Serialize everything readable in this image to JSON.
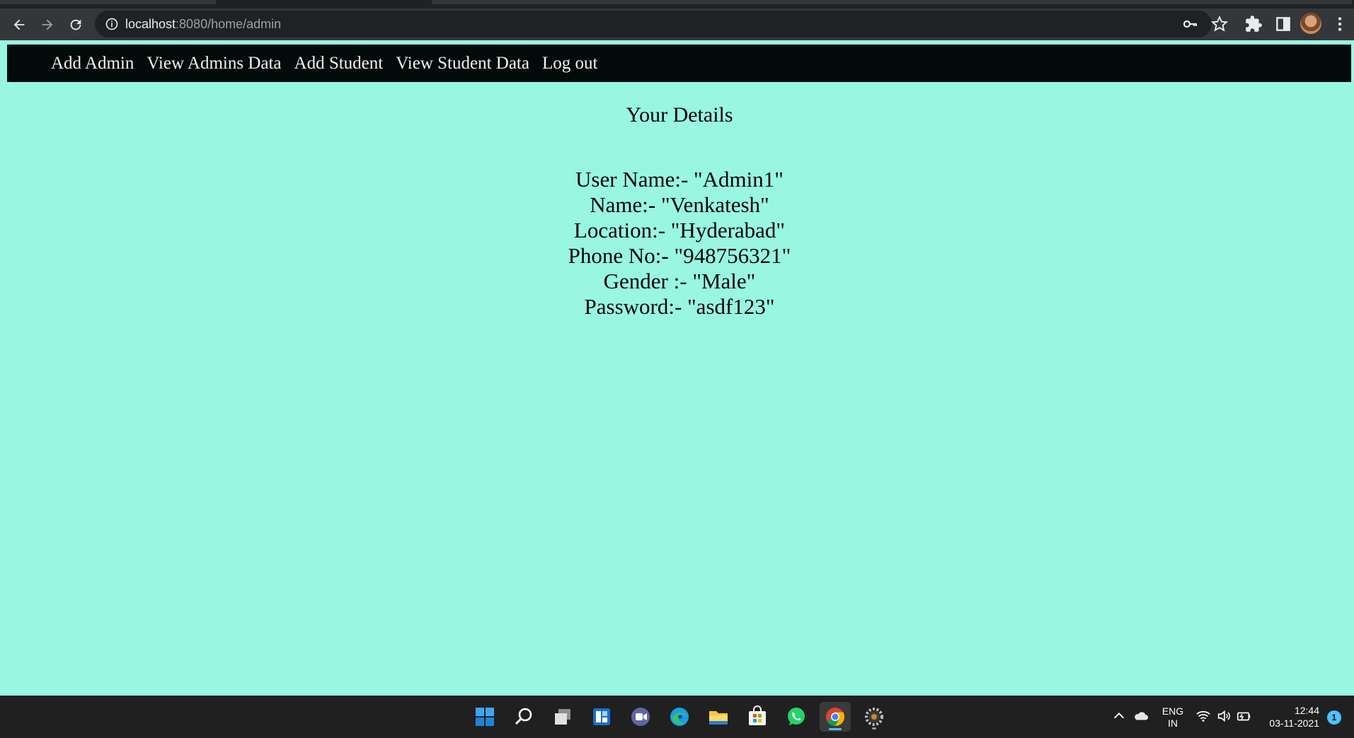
{
  "browser": {
    "url_host": "localhost",
    "url_path": ":8080/home/admin"
  },
  "nav": {
    "items": [
      {
        "label": "Add Admin"
      },
      {
        "label": "View Admins Data"
      },
      {
        "label": "Add Student"
      },
      {
        "label": "View Student Data"
      },
      {
        "label": "Log out"
      }
    ]
  },
  "main": {
    "title": "Your Details",
    "details": [
      "User Name:- \"Admin1\"",
      "Name:- \"Venkatesh\"",
      "Location:- \"Hyderabad\"",
      "Phone No:- \"948756321\"",
      "Gender :- \"Male\"",
      "Password:- \"asdf123\""
    ]
  },
  "taskbar": {
    "apps": [
      "start-icon",
      "search-icon",
      "task-view-icon",
      "widgets-icon",
      "teams-chat-icon",
      "edge-icon",
      "file-explorer-icon",
      "store-icon",
      "whatsapp-icon",
      "chrome-icon",
      "settings-icon"
    ],
    "lang_line1": "ENG",
    "lang_line2": "IN",
    "time": "12:44",
    "date": "03-11-2021",
    "notifications": "1"
  },
  "colors": {
    "page_background": "#98f6e2",
    "nav_background": "#030a0a",
    "nav_text": "#f2f2f2"
  }
}
